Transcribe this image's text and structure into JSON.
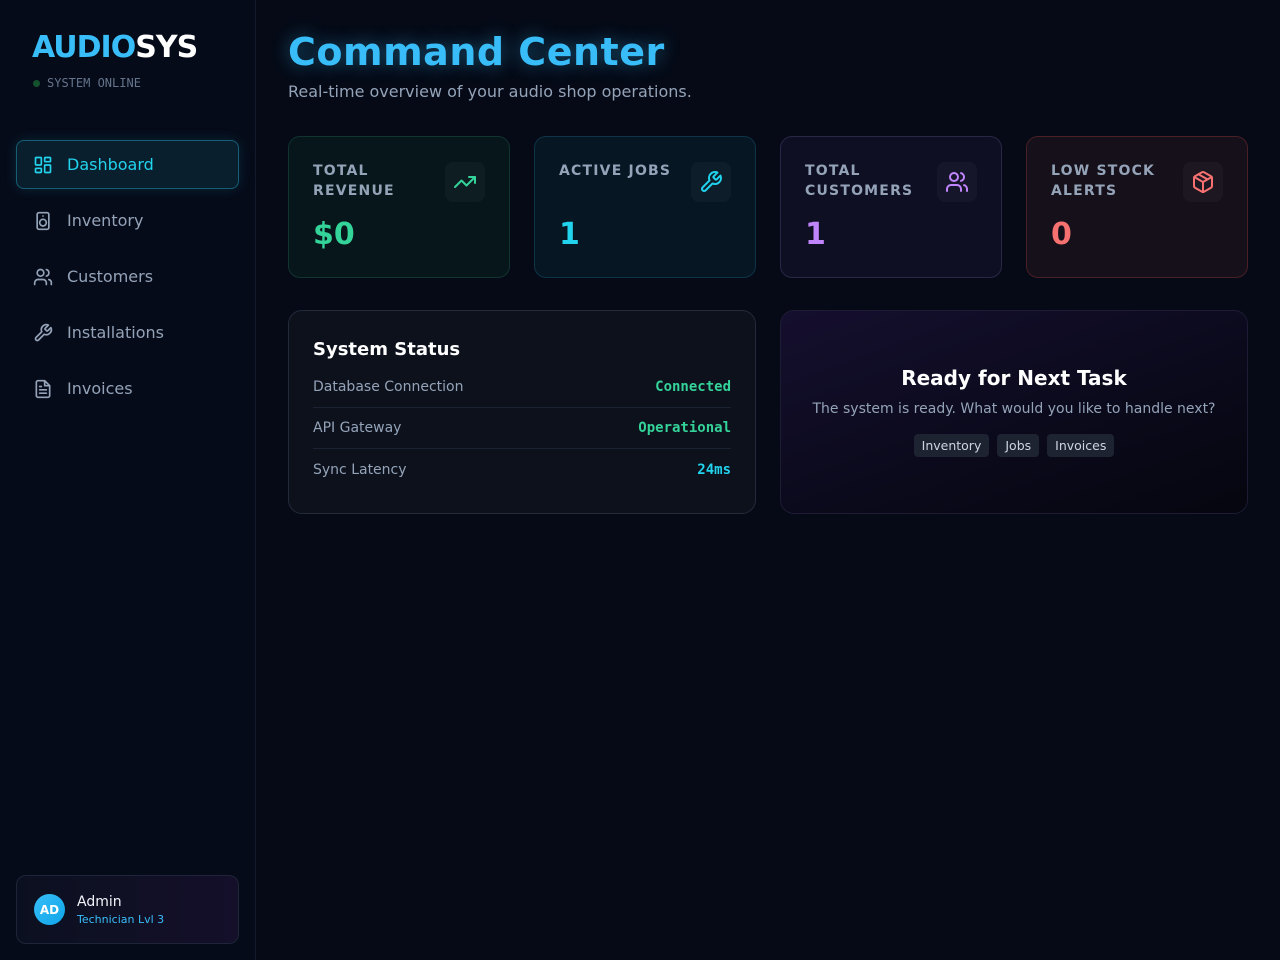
{
  "brand": {
    "part1": "AUDIO",
    "part2": "SYS",
    "status": "SYSTEM ONLINE"
  },
  "nav": {
    "items": [
      {
        "label": "Dashboard",
        "icon": "dashboard-icon",
        "active": true
      },
      {
        "label": "Inventory",
        "icon": "speaker-icon"
      },
      {
        "label": "Customers",
        "icon": "users-icon"
      },
      {
        "label": "Installations",
        "icon": "wrench-icon"
      },
      {
        "label": "Invoices",
        "icon": "document-icon"
      }
    ]
  },
  "user": {
    "initials": "AD",
    "name": "Admin",
    "role": "Technician Lvl 3"
  },
  "header": {
    "title": "Command Center",
    "subtitle": "Real-time overview of your audio shop operations."
  },
  "stats": [
    {
      "label": "Total Revenue",
      "value": "$0",
      "icon": "trending-up-icon",
      "color": "#34d399"
    },
    {
      "label": "Active Jobs",
      "value": "1",
      "icon": "wrench-icon",
      "color": "#22d3ee"
    },
    {
      "label": "Total Customers",
      "value": "1",
      "icon": "users-icon",
      "color": "#c084fc"
    },
    {
      "label": "Low Stock Alerts",
      "value": "0",
      "icon": "box-icon",
      "color": "#f87171"
    }
  ],
  "system_status": {
    "title": "System Status",
    "rows": [
      {
        "label": "Database Connection",
        "value": "Connected",
        "color": "#34d399"
      },
      {
        "label": "API Gateway",
        "value": "Operational",
        "color": "#34d399"
      },
      {
        "label": "Sync Latency",
        "value": "24ms",
        "color": "#22d3ee"
      }
    ]
  },
  "ready": {
    "title": "Ready for Next Task",
    "subtitle": "The system is ready. What would you like to handle next?",
    "chips": [
      "Inventory",
      "Jobs",
      "Invoices"
    ]
  }
}
